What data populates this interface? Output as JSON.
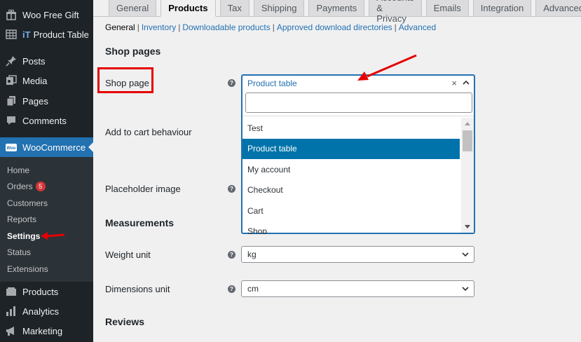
{
  "sidebar": {
    "items": [
      {
        "label": "Woo Free Gift",
        "icon": "gift-icon"
      },
      {
        "label": "Product Table",
        "icon": "table-icon",
        "prefix": "iT"
      },
      {
        "label": "Posts",
        "icon": "pin-icon"
      },
      {
        "label": "Media",
        "icon": "media-icon"
      },
      {
        "label": "Pages",
        "icon": "pages-icon"
      },
      {
        "label": "Comments",
        "icon": "comment-icon"
      },
      {
        "label": "WooCommerce",
        "icon": "woo-icon"
      },
      {
        "label": "Products",
        "icon": "products-icon"
      },
      {
        "label": "Analytics",
        "icon": "analytics-icon"
      },
      {
        "label": "Marketing",
        "icon": "megaphone-icon"
      }
    ],
    "woo_icon_text": "Woo",
    "submenu": [
      {
        "label": "Home"
      },
      {
        "label": "Orders",
        "badge": "5"
      },
      {
        "label": "Customers"
      },
      {
        "label": "Reports"
      },
      {
        "label": "Settings"
      },
      {
        "label": "Status"
      },
      {
        "label": "Extensions"
      }
    ]
  },
  "tabs": [
    "General",
    "Products",
    "Tax",
    "Shipping",
    "Payments",
    "Accounts & Privacy",
    "Emails",
    "Integration",
    "Advanced"
  ],
  "subnav": [
    "General",
    "Inventory",
    "Downloadable products",
    "Approved download directories",
    "Advanced"
  ],
  "sections": {
    "shop_pages": "Shop pages",
    "measurements": "Measurements",
    "reviews": "Reviews"
  },
  "fields": {
    "shop_page_label": "Shop page",
    "add_to_cart_label": "Add to cart behaviour",
    "placeholder_label": "Placeholder image",
    "weight_label": "Weight unit",
    "weight_value": "kg",
    "dimensions_label": "Dimensions unit",
    "dimensions_value": "cm"
  },
  "shop_select": {
    "selected": "Product table",
    "clear": "×",
    "options": [
      "Test",
      "Product table",
      "My account",
      "Checkout",
      "Cart",
      "Shop"
    ]
  },
  "help_glyph": "?",
  "colors": {
    "accent": "#2271b1",
    "highlight": "#e50000",
    "sidebar": "#1d2327",
    "badge": "#d63638"
  }
}
